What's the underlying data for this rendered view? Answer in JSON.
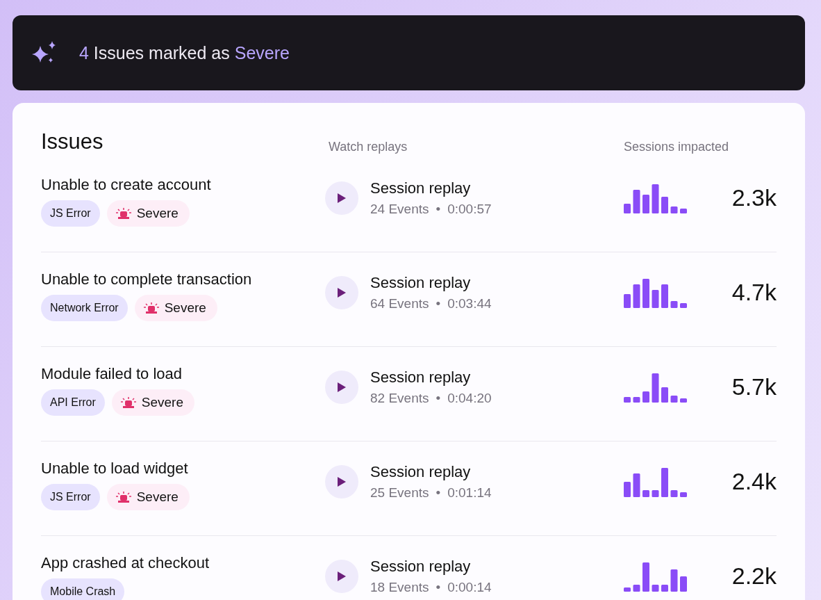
{
  "banner": {
    "count": "4",
    "text": "Issues marked as",
    "highlight": "Severe"
  },
  "issues": {
    "title": "Issues",
    "separator": "•",
    "columns": [
      "Watch replays",
      "Sessions impacted"
    ],
    "rows": [
      {
        "title": "Unable to create account",
        "badges": [
          {
            "kind": "type",
            "label": "JS Error"
          },
          {
            "kind": "severity",
            "label": "Severe"
          }
        ],
        "replay": "Session replay",
        "events": "24 Events",
        "duration": "0:00:57",
        "sessions": "2.3k"
      },
      {
        "title": "Unable to complete transaction",
        "badges": [
          {
            "kind": "type",
            "label": "Network Error"
          },
          {
            "kind": "severity",
            "label": "Severe"
          }
        ],
        "replay": "Session replay",
        "events": "64 Events",
        "duration": "0:03:44",
        "sessions": "4.7k"
      },
      {
        "title": "Module failed to load",
        "badges": [
          {
            "kind": "type",
            "label": "API Error"
          },
          {
            "kind": "severity",
            "label": "Severe"
          }
        ],
        "replay": "Session replay",
        "events": "82 Events",
        "duration": "0:04:20",
        "sessions": "5.7k"
      },
      {
        "title": "Unable to load widget",
        "badges": [
          {
            "kind": "type",
            "label": "JS Error"
          },
          {
            "kind": "severity",
            "label": "Severe"
          }
        ],
        "replay": "Session replay",
        "events": "25 Events",
        "duration": "0:01:14",
        "sessions": "2.4k"
      },
      {
        "title": "App crashed at checkout",
        "badges": [
          {
            "kind": "type",
            "label": "Mobile Crash"
          }
        ],
        "replay": "Session replay",
        "events": "18 Events",
        "duration": "0:00:14",
        "sessions": "2.2k"
      }
    ]
  }
}
